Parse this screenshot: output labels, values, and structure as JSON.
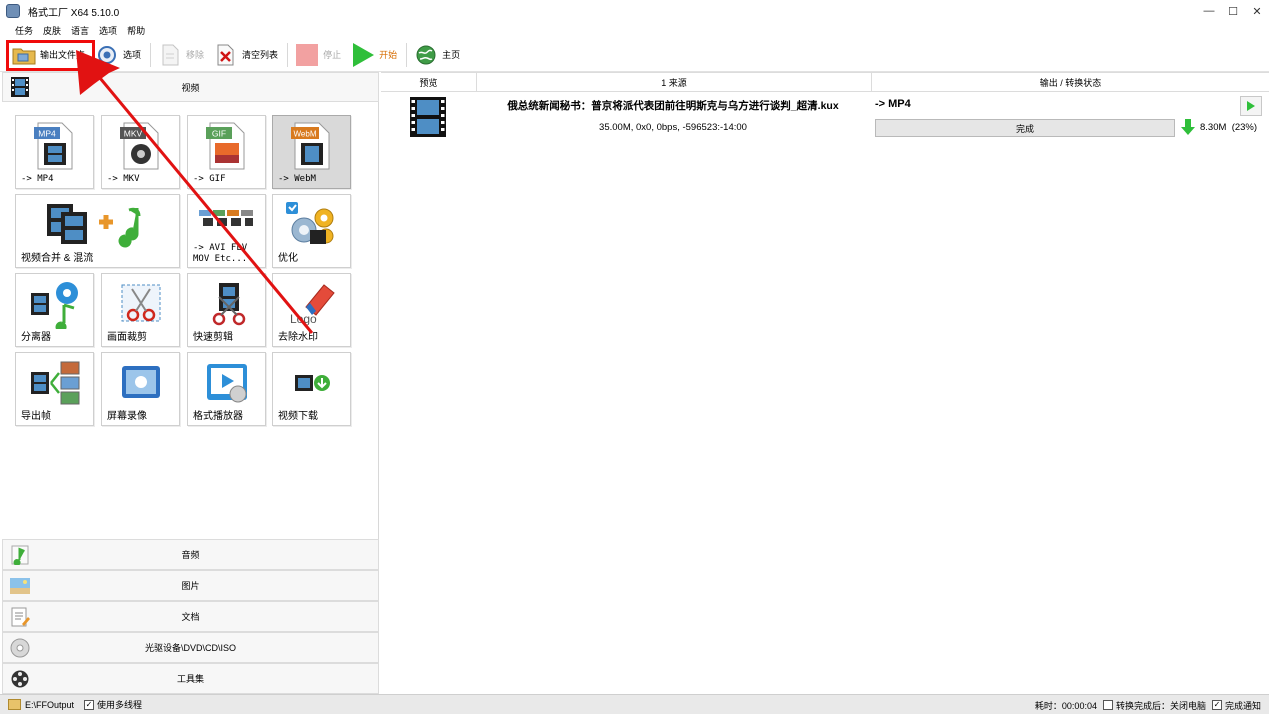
{
  "window": {
    "title": "格式工厂 X64 5.10.0",
    "minimize": "—",
    "maximize": "☐",
    "close": "✕"
  },
  "menu": [
    "任务",
    "皮肤",
    "语言",
    "选项",
    "帮助"
  ],
  "toolbar": {
    "output_folder": "输出文件夹",
    "options": "选项",
    "remove": "移除",
    "clear_list": "清空列表",
    "stop": "停止",
    "start": "开始",
    "home": "主页"
  },
  "categories": {
    "video": "视频",
    "audio": "音频",
    "picture": "图片",
    "document": "文档",
    "rom": "光驱设备\\DVD\\CD\\ISO",
    "tools": "工具集"
  },
  "tiles": {
    "mp4": {
      "label": "-> MP4",
      "badge": "MP4"
    },
    "mkv": {
      "label": "-> MKV",
      "badge": "MKV"
    },
    "gif": {
      "label": "-> GIF",
      "badge": "GIF"
    },
    "webm": {
      "label": "-> WebM",
      "badge": "WebM"
    },
    "merge": {
      "label": "视频合并 & 混流"
    },
    "avi": {
      "label": "-> AVI FLV\nMOV Etc..."
    },
    "optimize": {
      "label": "优化"
    },
    "splitter": {
      "label": "分离器"
    },
    "crop": {
      "label": "画面裁剪"
    },
    "quick_clip": {
      "label": "快速剪辑"
    },
    "watermark": {
      "label": "去除水印",
      "badge": "Logo"
    },
    "export_frames": {
      "label": "导出帧"
    },
    "screen_record": {
      "label": "屏幕录像"
    },
    "player": {
      "label": "格式播放器"
    },
    "download": {
      "label": "视频下载"
    }
  },
  "task_list": {
    "headers": {
      "preview": "预览",
      "source": "1 来源",
      "status": "输出 / 转换状态"
    },
    "tasks": [
      {
        "source_name": "俄总统新闻秘书：普京将派代表团前往明斯克与乌方进行谈判_超清.kux",
        "source_info": "35.00M, 0x0, 0bps, -596523:-14:00",
        "output_format": "-> MP4",
        "status": "完成",
        "output_size": "8.30M",
        "ratio": "(23%)"
      }
    ]
  },
  "statusbar": {
    "output_path": "E:\\FFOutput",
    "multithread_label": "使用多线程",
    "elapsed": "耗时：00:00:04",
    "after_convert": "转换完成后：关闭电脑",
    "notify": "完成通知",
    "checked": "✓"
  },
  "colors": {
    "highlight": "#f00b0b",
    "start_green": "#2fbf3a",
    "start_label": "#d66c00",
    "stop_disabled": "#f2a1a1",
    "download_arrow": "#2fbf3a",
    "status_bar": "#e9e9e9"
  }
}
